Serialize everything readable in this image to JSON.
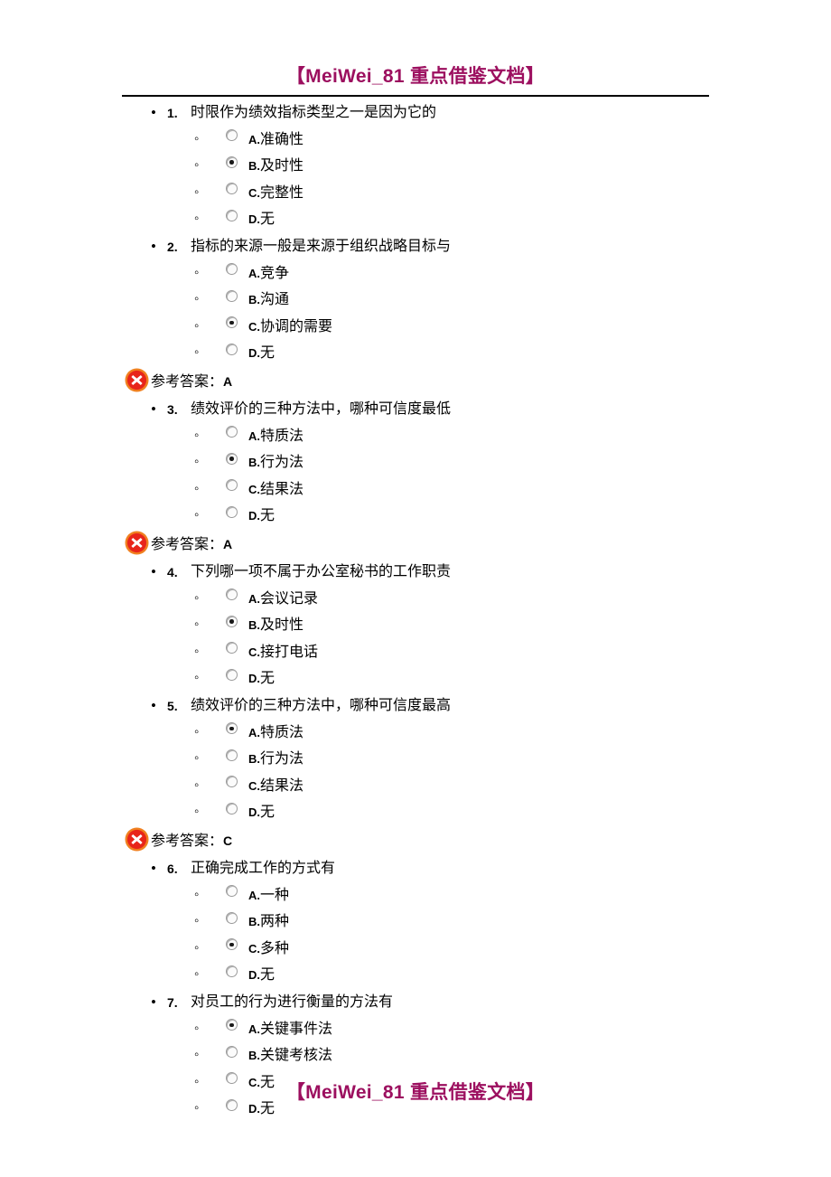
{
  "header": {
    "watermark": "【MeiWei_81 重点借鉴文档】"
  },
  "footer": {
    "watermark": "【MeiWei_81 重点借鉴文档】"
  },
  "answer_prefix": "参考答案：",
  "icons": {
    "wrong": "red-x-icon"
  },
  "colors": {
    "watermark": "#9C0F5F",
    "icon_outer": "#F08020",
    "icon_inner": "#E8251A",
    "rule": "#000000"
  },
  "questions": [
    {
      "num": "1.",
      "text": "时限作为绩效指标类型之一是因为它的",
      "options": [
        {
          "letter": "A.",
          "label": "准确性",
          "checked": false
        },
        {
          "letter": "B.",
          "label": "及时性",
          "checked": true
        },
        {
          "letter": "C.",
          "label": "完整性",
          "checked": false
        },
        {
          "letter": "D.",
          "label": "无",
          "checked": false
        }
      ],
      "answer": null
    },
    {
      "num": "2.",
      "text": "指标的来源一般是来源于组织战略目标与",
      "options": [
        {
          "letter": "A.",
          "label": "竞争",
          "checked": false
        },
        {
          "letter": "B.",
          "label": "沟通",
          "checked": false
        },
        {
          "letter": "C.",
          "label": "协调的需要",
          "checked": true
        },
        {
          "letter": "D.",
          "label": "无",
          "checked": false
        }
      ],
      "answer": "A"
    },
    {
      "num": "3.",
      "text": "绩效评价的三种方法中，哪种可信度最低",
      "options": [
        {
          "letter": "A.",
          "label": "特质法",
          "checked": false
        },
        {
          "letter": "B.",
          "label": "行为法",
          "checked": true
        },
        {
          "letter": "C.",
          "label": "结果法",
          "checked": false
        },
        {
          "letter": "D.",
          "label": "无",
          "checked": false
        }
      ],
      "answer": "A"
    },
    {
      "num": "4.",
      "text": "下列哪一项不属于办公室秘书的工作职责",
      "options": [
        {
          "letter": "A.",
          "label": "会议记录",
          "checked": false
        },
        {
          "letter": "B.",
          "label": "及时性",
          "checked": true
        },
        {
          "letter": "C.",
          "label": "接打电话",
          "checked": false
        },
        {
          "letter": "D.",
          "label": "无",
          "checked": false
        }
      ],
      "answer": null
    },
    {
      "num": "5.",
      "text": "绩效评价的三种方法中，哪种可信度最高",
      "options": [
        {
          "letter": "A.",
          "label": "特质法",
          "checked": true
        },
        {
          "letter": "B.",
          "label": "行为法",
          "checked": false
        },
        {
          "letter": "C.",
          "label": "结果法",
          "checked": false
        },
        {
          "letter": "D.",
          "label": "无",
          "checked": false
        }
      ],
      "answer": "C"
    },
    {
      "num": "6.",
      "text": "正确完成工作的方式有",
      "options": [
        {
          "letter": "A.",
          "label": "一种",
          "checked": false
        },
        {
          "letter": "B.",
          "label": "两种",
          "checked": false
        },
        {
          "letter": "C.",
          "label": "多种",
          "checked": true
        },
        {
          "letter": "D.",
          "label": "无",
          "checked": false
        }
      ],
      "answer": null
    },
    {
      "num": "7.",
      "text": "对员工的行为进行衡量的方法有",
      "options": [
        {
          "letter": "A.",
          "label": "关键事件法",
          "checked": true
        },
        {
          "letter": "B.",
          "label": "关键考核法",
          "checked": false
        },
        {
          "letter": "C.",
          "label": "无",
          "checked": false
        },
        {
          "letter": "D.",
          "label": "无",
          "checked": false
        }
      ],
      "answer": null
    }
  ]
}
